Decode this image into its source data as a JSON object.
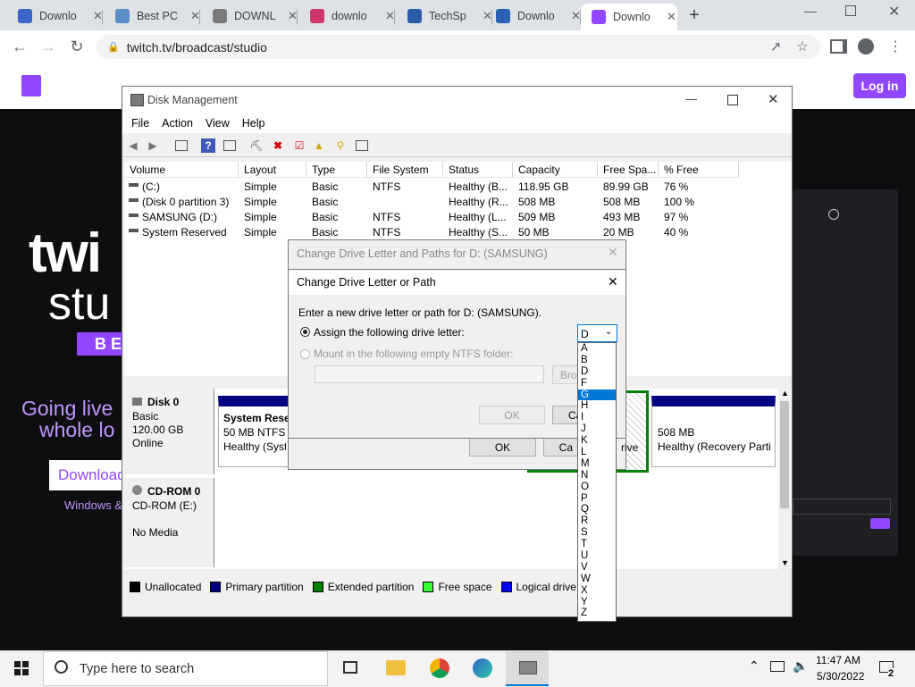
{
  "browser": {
    "tabs": [
      {
        "icon": "tab-icon-download",
        "title": "Downlo"
      },
      {
        "icon": "tab-icon-bestpc",
        "title": "Best PC"
      },
      {
        "icon": "tab-icon-download-site",
        "title": "DOWNL"
      },
      {
        "icon": "tab-icon-download-red",
        "title": "downlo"
      },
      {
        "icon": "tab-icon-techspot",
        "title": "TechSp"
      },
      {
        "icon": "tab-icon-sourceforge",
        "title": "Downlo"
      },
      {
        "icon": "tab-icon-twitch",
        "title": "Downlo"
      }
    ],
    "url": "twitch.tv/broadcast/studio"
  },
  "twitch": {
    "login_label": "Log in",
    "hero_line1": "twi",
    "hero_line2": "stu",
    "badge": "B E",
    "going_live": "Going live",
    "whole_lo": "whole lo",
    "download_label": "Download",
    "windows_label": "Windows &"
  },
  "disk_management": {
    "title": "Disk Management",
    "menu": [
      "File",
      "Action",
      "View",
      "Help"
    ],
    "columns": [
      "Volume",
      "Layout",
      "Type",
      "File System",
      "Status",
      "Capacity",
      "Free Spa...",
      "% Free"
    ],
    "volumes": [
      [
        "(C:)",
        "Simple",
        "Basic",
        "NTFS",
        "Healthy (B...",
        "118.95 GB",
        "89.99 GB",
        "76 %"
      ],
      [
        "(Disk 0 partition 3)",
        "Simple",
        "Basic",
        "",
        "Healthy (R...",
        "508 MB",
        "508 MB",
        "100 %"
      ],
      [
        "SAMSUNG (D:)",
        "Simple",
        "Basic",
        "NTFS",
        "Healthy (L...",
        "509 MB",
        "493 MB",
        "97 %"
      ],
      [
        "System Reserved",
        "Simple",
        "Basic",
        "NTFS",
        "Healthy (S...",
        "50 MB",
        "20 MB",
        "40 %"
      ]
    ],
    "disk0": {
      "name": "Disk 0",
      "type": "Basic",
      "size": "120.00 GB",
      "state": "Online"
    },
    "disk0_part1": {
      "name": "System Rese",
      "size": "50 MB NTFS",
      "status": "Healthy (Syste"
    },
    "disk0_part_last": {
      "size": "508 MB",
      "status": "Healthy (Recovery Parti"
    },
    "cdrom": {
      "name": "CD-ROM 0",
      "drive": "CD-ROM (E:)",
      "media": "No Media"
    },
    "legend": [
      {
        "label": "Unallocated",
        "color": "#000000"
      },
      {
        "label": "Primary partition",
        "color": "#000080"
      },
      {
        "label": "Extended partition",
        "color": "#008000"
      },
      {
        "label": "Free space",
        "color": "#33ff33"
      },
      {
        "label": "Logical drive",
        "color": "#0000ff"
      }
    ]
  },
  "outer_dialog": {
    "title": "Change Drive Letter and Paths for D: (SAMSUNG)",
    "ok_label": "OK",
    "cancel_label": "Ca",
    "frag_drive": "rive"
  },
  "inner_dialog": {
    "title": "Change Drive Letter or Path",
    "instruction": "Enter a new drive letter or path for D: (SAMSUNG).",
    "assign_label": "Assign the following drive letter:",
    "mount_label": "Mount in the following empty NTFS folder:",
    "browse_label": "Bro",
    "ok_label": "OK",
    "cancel_label": "Ca",
    "selected_letter": "D",
    "letters": [
      "A",
      "B",
      "D",
      "F",
      "G",
      "H",
      "I",
      "J",
      "K",
      "L",
      "M",
      "N",
      "O",
      "P",
      "Q",
      "R",
      "S",
      "T",
      "U",
      "V",
      "W",
      "X",
      "Y",
      "Z"
    ],
    "highlighted_letter": "G"
  },
  "taskbar": {
    "search_placeholder": "Type here to search",
    "time": "11:47 AM",
    "date": "5/30/2022",
    "notification_count": "2"
  }
}
